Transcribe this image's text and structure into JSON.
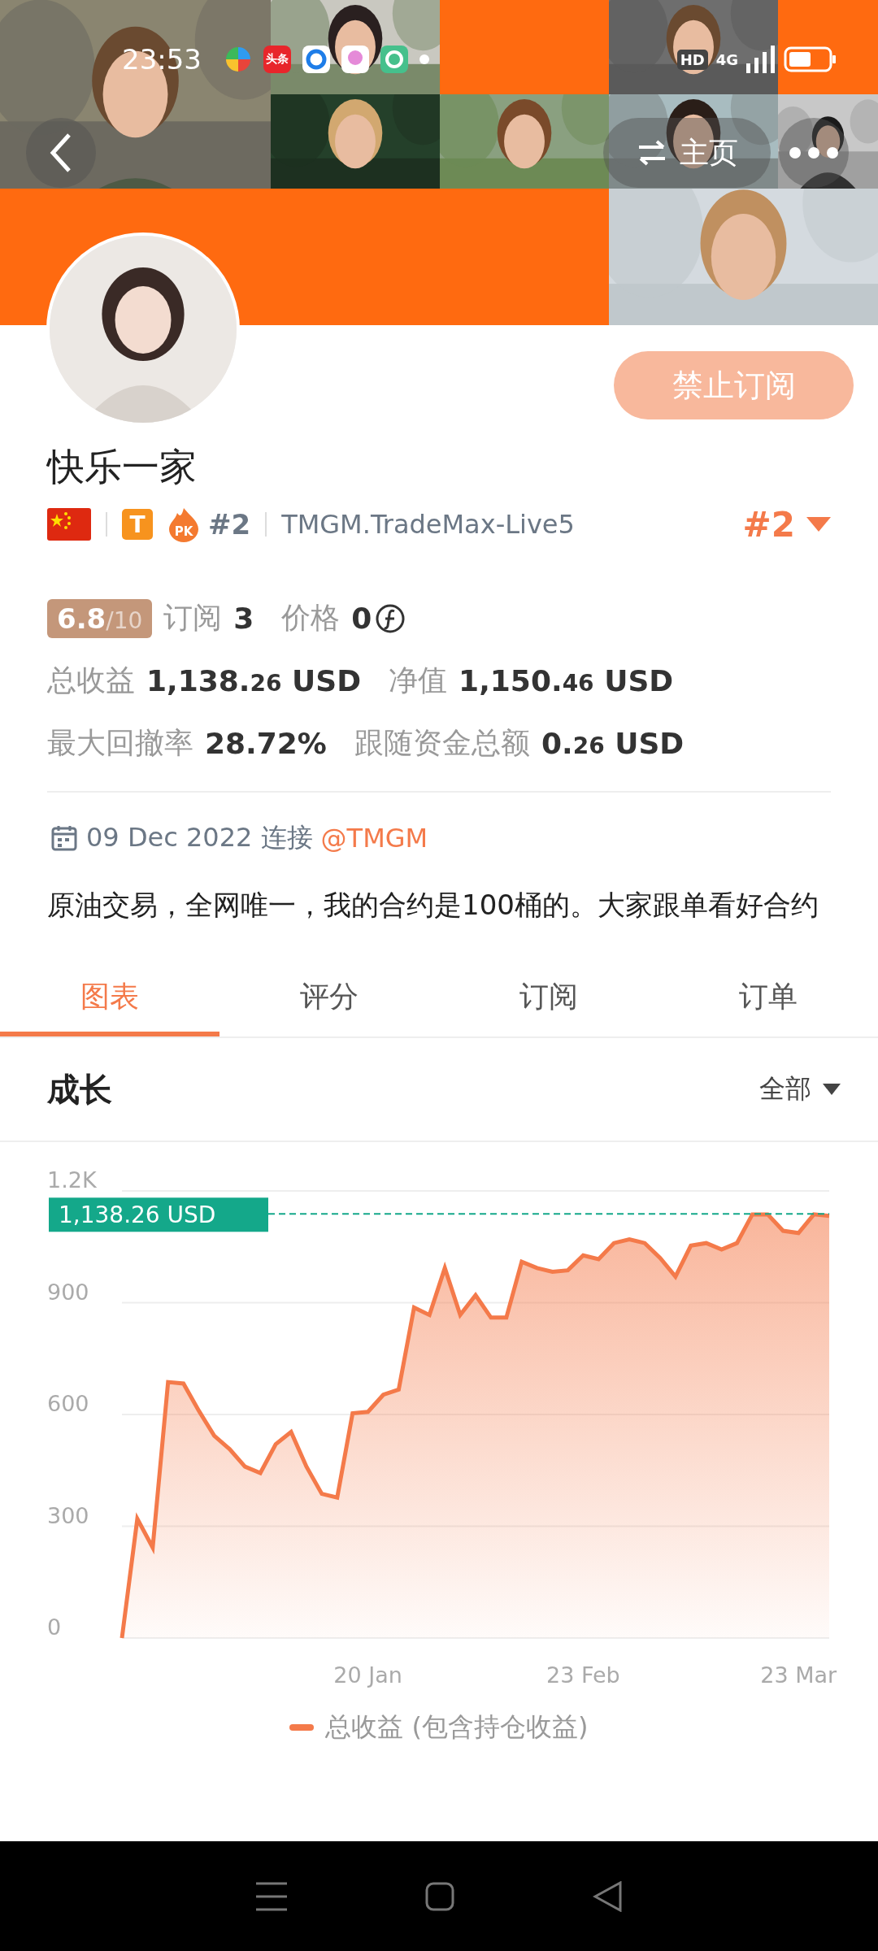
{
  "status_bar": {
    "time": "23:53",
    "notifications": [
      {
        "kind": "pinwheel"
      },
      {
        "kind": "news",
        "label": "头条"
      },
      {
        "kind": "ring"
      },
      {
        "kind": "balloon"
      },
      {
        "kind": "camera"
      },
      {
        "kind": "dot"
      }
    ],
    "hd": "HD",
    "network": "4G"
  },
  "header": {
    "back": true,
    "home_label": "主页",
    "more": true
  },
  "profile": {
    "subscribe_button": {
      "label": "禁止订阅",
      "disabled": true
    },
    "name": "快乐一家",
    "tier": "T",
    "pk": "PK",
    "rank": "#2",
    "server": "TMGM.TradeMax-Live5",
    "rank_selector": "#2"
  },
  "stats": {
    "rating": "6.8",
    "rating_max": "/10",
    "subscriptions_label": "订阅",
    "subscriptions": "3",
    "price_label": "价格",
    "price": "0",
    "rows": [
      [
        {
          "label": "总收益",
          "main": "1,138.",
          "fraction": "26",
          "unit": " USD"
        },
        {
          "label": "净值",
          "main": "1,150.",
          "fraction": "46",
          "unit": " USD"
        }
      ],
      [
        {
          "label": "最大回撤率",
          "main": "28.72%"
        },
        {
          "label": "跟随资金总额",
          "main": "0.",
          "fraction": "26",
          "unit": " USD"
        }
      ]
    ]
  },
  "connection": {
    "date": "09 Dec 2022 连接",
    "broker": "@TMGM"
  },
  "description": "原油交易，全网唯一，我的合约是100桶的。大家跟单看好合约",
  "tabs": [
    {
      "label": "图表",
      "selected": true
    },
    {
      "label": "评分",
      "selected": false
    },
    {
      "label": "订阅",
      "selected": false
    },
    {
      "label": "订单",
      "selected": false
    }
  ],
  "growth": {
    "title": "成长",
    "filter": "全部",
    "chart_data": {
      "type": "area",
      "categories": [
        null,
        null,
        null,
        null,
        null,
        null,
        null,
        null,
        null,
        null,
        null,
        null,
        null,
        null,
        null,
        null,
        "20 Jan",
        null,
        null,
        null,
        null,
        null,
        null,
        null,
        null,
        null,
        null,
        null,
        null,
        null,
        "23 Feb",
        null,
        null,
        null,
        null,
        null,
        null,
        null,
        null,
        null,
        null,
        null,
        null,
        null,
        "23 Mar",
        null,
        null
      ],
      "series": [
        {
          "name": "总收益 (包含持仓收益)",
          "color": "#f47a4a",
          "values": [
            0,
            320,
            243,
            687,
            683,
            610,
            543,
            507,
            460,
            443,
            520,
            553,
            460,
            387,
            377,
            603,
            607,
            653,
            667,
            887,
            867,
            993,
            867,
            920,
            860,
            860,
            1010,
            993,
            983,
            987,
            1027,
            1017,
            1060,
            1070,
            1060,
            1020,
            970,
            1053,
            1060,
            1043,
            1060,
            1137,
            1137,
            1093,
            1087,
            1137,
            1133
          ]
        }
      ],
      "grid": true,
      "ylim": [
        0,
        1200
      ],
      "yticks": [
        0,
        300,
        600,
        900,
        {
          "value": 1200,
          "label": "1.2K"
        }
      ],
      "ref_lines": [
        {
          "axis": "y",
          "value": 1138.26,
          "label": "1,138.26 USD"
        }
      ]
    }
  }
}
